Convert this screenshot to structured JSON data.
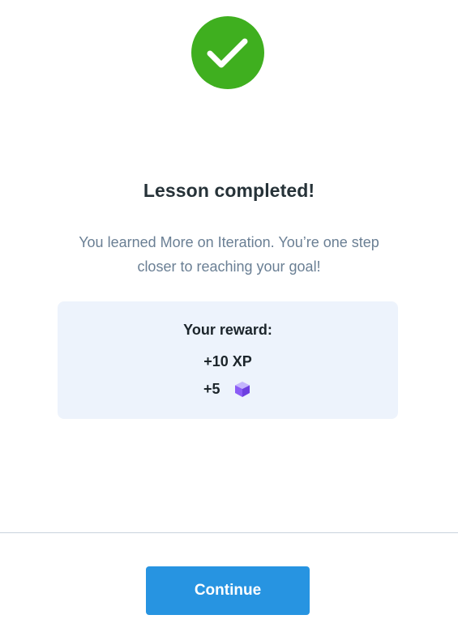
{
  "status": {
    "icon": "checkmark-icon",
    "color": "#3faf1f"
  },
  "title": "Lesson completed!",
  "message": "You learned More on Iteration. You’re one step closer to reaching your goal!",
  "reward": {
    "heading": "Your reward:",
    "xp": "+10 XP",
    "gems": "+5",
    "gem_icon": "gem-cube-icon"
  },
  "continue_label": "Continue",
  "colors": {
    "accent": "#2794e1",
    "card_background": "#edf3fc",
    "gem": "#8b5cf6"
  }
}
